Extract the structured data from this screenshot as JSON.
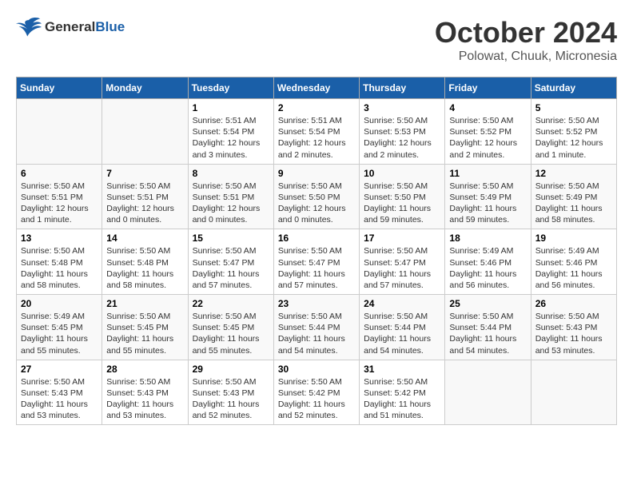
{
  "header": {
    "logo_line1": "General",
    "logo_line2": "Blue",
    "month": "October 2024",
    "location": "Polowat, Chuuk, Micronesia"
  },
  "days_of_week": [
    "Sunday",
    "Monday",
    "Tuesday",
    "Wednesday",
    "Thursday",
    "Friday",
    "Saturday"
  ],
  "weeks": [
    [
      {
        "day": "",
        "empty": true
      },
      {
        "day": "",
        "empty": true
      },
      {
        "day": "1",
        "sunrise": "5:51 AM",
        "sunset": "5:54 PM",
        "daylight": "12 hours and 3 minutes."
      },
      {
        "day": "2",
        "sunrise": "5:51 AM",
        "sunset": "5:54 PM",
        "daylight": "12 hours and 2 minutes."
      },
      {
        "day": "3",
        "sunrise": "5:50 AM",
        "sunset": "5:53 PM",
        "daylight": "12 hours and 2 minutes."
      },
      {
        "day": "4",
        "sunrise": "5:50 AM",
        "sunset": "5:52 PM",
        "daylight": "12 hours and 2 minutes."
      },
      {
        "day": "5",
        "sunrise": "5:50 AM",
        "sunset": "5:52 PM",
        "daylight": "12 hours and 1 minute."
      }
    ],
    [
      {
        "day": "6",
        "sunrise": "5:50 AM",
        "sunset": "5:51 PM",
        "daylight": "12 hours and 1 minute."
      },
      {
        "day": "7",
        "sunrise": "5:50 AM",
        "sunset": "5:51 PM",
        "daylight": "12 hours and 0 minutes."
      },
      {
        "day": "8",
        "sunrise": "5:50 AM",
        "sunset": "5:51 PM",
        "daylight": "12 hours and 0 minutes."
      },
      {
        "day": "9",
        "sunrise": "5:50 AM",
        "sunset": "5:50 PM",
        "daylight": "12 hours and 0 minutes."
      },
      {
        "day": "10",
        "sunrise": "5:50 AM",
        "sunset": "5:50 PM",
        "daylight": "11 hours and 59 minutes."
      },
      {
        "day": "11",
        "sunrise": "5:50 AM",
        "sunset": "5:49 PM",
        "daylight": "11 hours and 59 minutes."
      },
      {
        "day": "12",
        "sunrise": "5:50 AM",
        "sunset": "5:49 PM",
        "daylight": "11 hours and 58 minutes."
      }
    ],
    [
      {
        "day": "13",
        "sunrise": "5:50 AM",
        "sunset": "5:48 PM",
        "daylight": "11 hours and 58 minutes."
      },
      {
        "day": "14",
        "sunrise": "5:50 AM",
        "sunset": "5:48 PM",
        "daylight": "11 hours and 58 minutes."
      },
      {
        "day": "15",
        "sunrise": "5:50 AM",
        "sunset": "5:47 PM",
        "daylight": "11 hours and 57 minutes."
      },
      {
        "day": "16",
        "sunrise": "5:50 AM",
        "sunset": "5:47 PM",
        "daylight": "11 hours and 57 minutes."
      },
      {
        "day": "17",
        "sunrise": "5:50 AM",
        "sunset": "5:47 PM",
        "daylight": "11 hours and 57 minutes."
      },
      {
        "day": "18",
        "sunrise": "5:49 AM",
        "sunset": "5:46 PM",
        "daylight": "11 hours and 56 minutes."
      },
      {
        "day": "19",
        "sunrise": "5:49 AM",
        "sunset": "5:46 PM",
        "daylight": "11 hours and 56 minutes."
      }
    ],
    [
      {
        "day": "20",
        "sunrise": "5:49 AM",
        "sunset": "5:45 PM",
        "daylight": "11 hours and 55 minutes."
      },
      {
        "day": "21",
        "sunrise": "5:50 AM",
        "sunset": "5:45 PM",
        "daylight": "11 hours and 55 minutes."
      },
      {
        "day": "22",
        "sunrise": "5:50 AM",
        "sunset": "5:45 PM",
        "daylight": "11 hours and 55 minutes."
      },
      {
        "day": "23",
        "sunrise": "5:50 AM",
        "sunset": "5:44 PM",
        "daylight": "11 hours and 54 minutes."
      },
      {
        "day": "24",
        "sunrise": "5:50 AM",
        "sunset": "5:44 PM",
        "daylight": "11 hours and 54 minutes."
      },
      {
        "day": "25",
        "sunrise": "5:50 AM",
        "sunset": "5:44 PM",
        "daylight": "11 hours and 54 minutes."
      },
      {
        "day": "26",
        "sunrise": "5:50 AM",
        "sunset": "5:43 PM",
        "daylight": "11 hours and 53 minutes."
      }
    ],
    [
      {
        "day": "27",
        "sunrise": "5:50 AM",
        "sunset": "5:43 PM",
        "daylight": "11 hours and 53 minutes."
      },
      {
        "day": "28",
        "sunrise": "5:50 AM",
        "sunset": "5:43 PM",
        "daylight": "11 hours and 53 minutes."
      },
      {
        "day": "29",
        "sunrise": "5:50 AM",
        "sunset": "5:43 PM",
        "daylight": "11 hours and 52 minutes."
      },
      {
        "day": "30",
        "sunrise": "5:50 AM",
        "sunset": "5:42 PM",
        "daylight": "11 hours and 52 minutes."
      },
      {
        "day": "31",
        "sunrise": "5:50 AM",
        "sunset": "5:42 PM",
        "daylight": "11 hours and 51 minutes."
      },
      {
        "day": "",
        "empty": true
      },
      {
        "day": "",
        "empty": true
      }
    ]
  ]
}
